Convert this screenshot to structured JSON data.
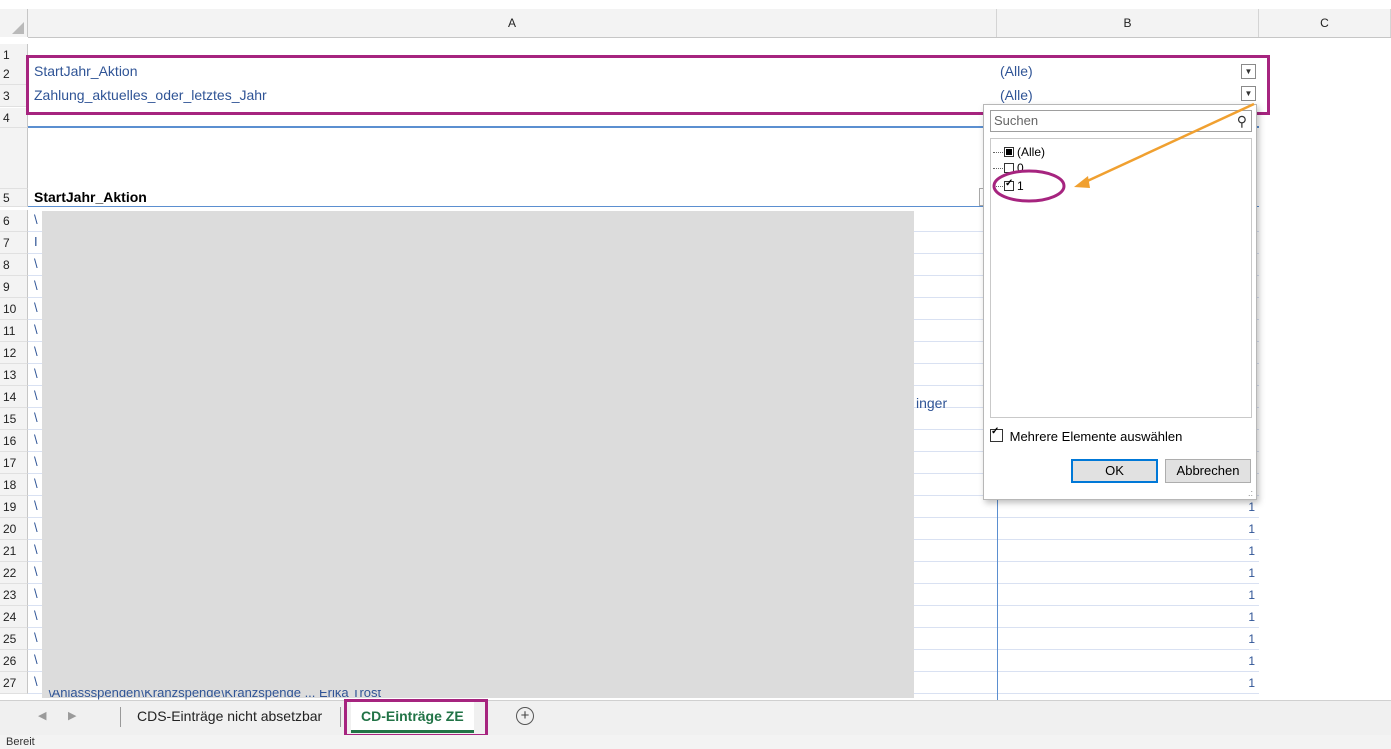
{
  "columns": [
    "A",
    "B",
    "C"
  ],
  "rows": [
    "1",
    "2",
    "3",
    "4",
    "5",
    "6",
    "7",
    "8",
    "9",
    "10",
    "11",
    "12",
    "13",
    "14",
    "15",
    "16",
    "17",
    "18",
    "19",
    "20",
    "21",
    "22",
    "23",
    "24",
    "25",
    "26",
    "27"
  ],
  "filters": [
    {
      "field": "StartJahr_Aktion",
      "value": "(Alle)"
    },
    {
      "field": "Zahlung_aktuelles_oder_letztes_Jahr",
      "value": "(Alle)"
    }
  ],
  "row5_header": "StartJahr_Aktion",
  "row_prefixes": {
    "r6": "\\",
    "r7": "I",
    "r8": "\\",
    "r9": "\\",
    "r10": "\\",
    "r11": "\\",
    "r12": "\\",
    "r13": "\\",
    "r14": "\\",
    "r15": "\\",
    "r16": "\\",
    "r17": "\\",
    "r18": "\\",
    "r19": "\\",
    "r20": "\\",
    "r21": "\\",
    "r22": "\\",
    "r23": "\\",
    "r24": "\\",
    "r25": "\\",
    "r26": "\\",
    "r27": "\\"
  },
  "row14_suffix": "inger",
  "row27_partial": "\\Anlassspenden\\Kranzspende\\Kranzspende ... Erika Trost",
  "b_values": {
    "r19": "1",
    "r20": "1",
    "r21": "1",
    "r22": "1",
    "r23": "1",
    "r24": "1",
    "r25": "1",
    "r26": "1",
    "r27": "1"
  },
  "filter_panel": {
    "search_placeholder": "Suchen",
    "items": [
      {
        "label": "(Alle)",
        "state": "partial"
      },
      {
        "label": "0",
        "state": "unchecked"
      },
      {
        "label": "1",
        "state": "checked"
      }
    ],
    "multi_select_label": "Mehrere Elemente auswählen",
    "ok_label": "OK",
    "cancel_label": "Abbrechen"
  },
  "sheet_tabs": [
    "CDS-Einträge nicht absetzbar",
    "CD-Einträge ZE"
  ],
  "active_tab": "CD-Einträge ZE",
  "status_text": "Bereit",
  "colors": {
    "highlight": "#a6247f",
    "arrow": "#f0a030",
    "link_text": "#2f5496",
    "tab_active": "#217346"
  }
}
